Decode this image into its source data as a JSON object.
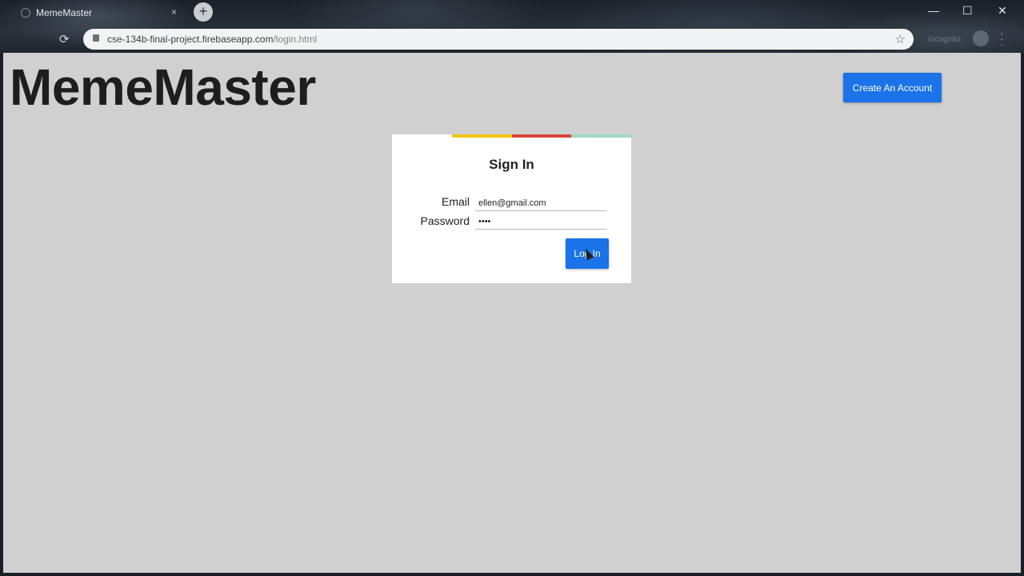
{
  "browser": {
    "tab_title": "MemeMaster",
    "tab_close": "×",
    "new_tab": "+",
    "url_host": "cse-134b-final-project.firebaseapp.com",
    "url_path": "/login.html",
    "reload_glyph": "⟳",
    "star_glyph": "☆",
    "incognito_label": "Incognito",
    "window_controls": {
      "minimize": "—",
      "maximize": "☐",
      "close": "✕"
    }
  },
  "header": {
    "app_title": "MemeMaster",
    "create_account_label": "Create An Account"
  },
  "signin": {
    "title": "Sign In",
    "email_label": "Email",
    "email_value": "ellen@gmail.com",
    "password_label": "Password",
    "password_value": "••••",
    "login_label": "Log In"
  },
  "colors": {
    "accent_blue": "#1a73e8",
    "page_background": "#d0d0d0",
    "stripe": [
      "#ffffff",
      "#f4c20d",
      "#db4437",
      "#9fd8c0"
    ]
  },
  "icons": {
    "reload": "reload-icon",
    "lock": "lock-icon",
    "star": "bookmark-star-icon",
    "profile": "profile-avatar-icon",
    "menu": "menu-dots-icon",
    "cursor": "mouse-cursor-icon"
  }
}
